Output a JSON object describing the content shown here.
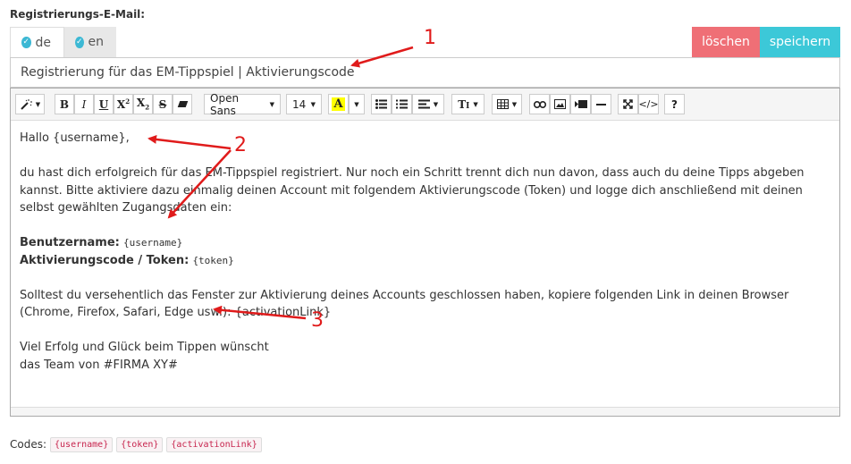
{
  "field": {
    "label": "Registrierungs-E-Mail:"
  },
  "tabs": [
    {
      "label": "de"
    },
    {
      "label": "en"
    }
  ],
  "buttons": {
    "delete": "löschen",
    "save": "speichern"
  },
  "subject": {
    "value": "Registrierung für das EM-Tippspiel | Aktivierungscode"
  },
  "toolbar": {
    "font_family": "Open Sans",
    "font_size": "14"
  },
  "content": {
    "greeting": "Hallo {username},",
    "para1": "du hast dich erfolgreich für das EM-Tippspiel registriert. Nur noch ein Schritt trennt dich nun davon, dass auch du deine Tipps abgeben kannst. Bitte aktiviere dazu einmalig deinen Account mit folgendem Aktivierungscode (Token) und logge dich anschließend mit deinen selbst gewählten Zugangsdaten ein:",
    "username_label": "Benutzername:",
    "username_value": "{username}",
    "token_label": "Aktivierungscode / Token:",
    "token_value": "{token}",
    "para2": "Solltest du versehentlich das Fenster zur Aktivierung deines Accounts geschlossen haben, kopiere folgenden Link in deinen Browser (Chrome, Firefox, Safari, Edge usw.): {activationLink}",
    "closing1": "Viel Erfolg und Glück beim Tippen wünscht",
    "closing2": "das Team von #FIRMA XY#"
  },
  "codes": {
    "label": "Codes:",
    "items": [
      "{username}",
      "{token}",
      "{activationLink}"
    ]
  },
  "annotations": [
    "1",
    "2",
    "3"
  ],
  "colors": {
    "accent_red": "#e01b1b",
    "delete_btn": "#ef6f76",
    "save_btn": "#3cc8d8",
    "check": "#3cb8d4"
  }
}
